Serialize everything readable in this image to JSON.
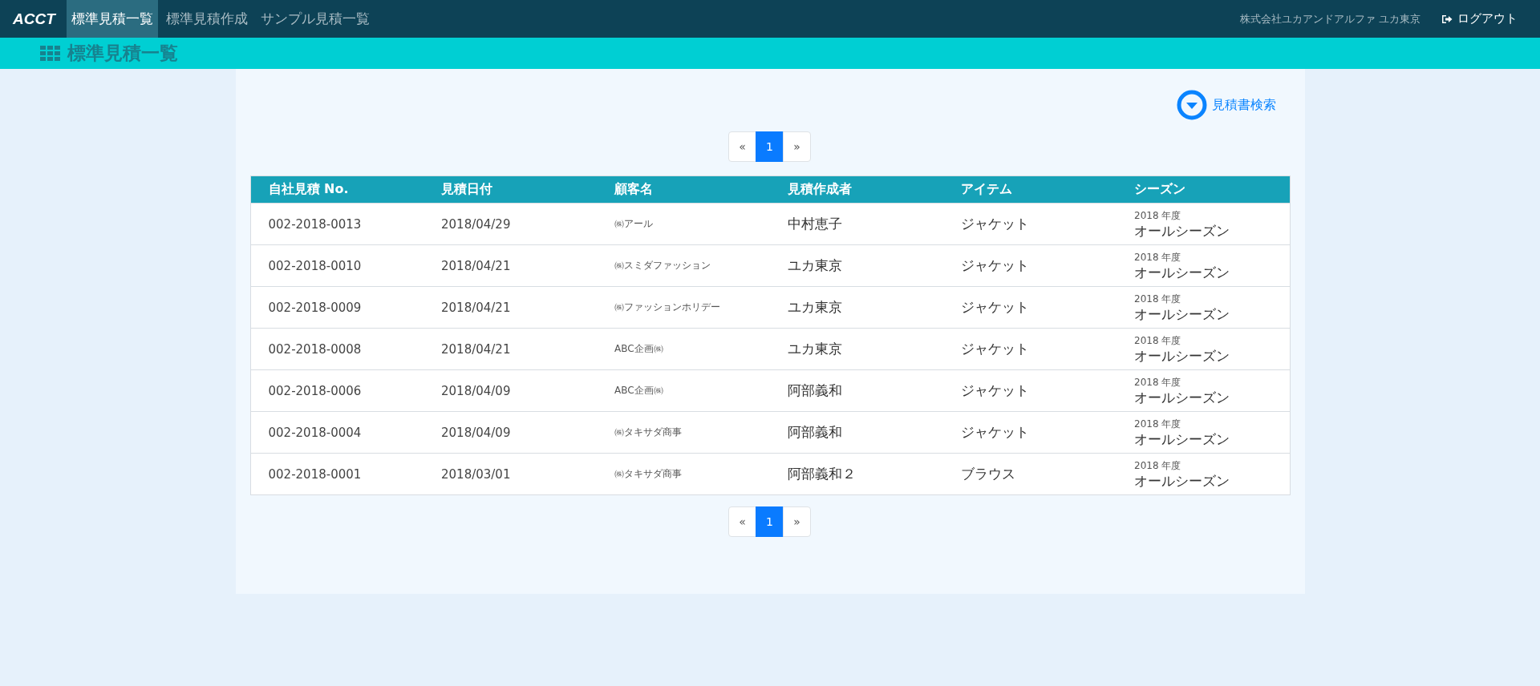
{
  "navbar": {
    "logo": "ACCT",
    "tabs": [
      {
        "label": "標準見積一覧",
        "selected": true
      },
      {
        "label": "標準見積作成",
        "selected": false
      },
      {
        "label": "サンプル見積一覧",
        "selected": false
      }
    ],
    "company": "株式会社ユカアンドアルファ ユカ東京",
    "logout": "ログアウト"
  },
  "page_title": "標準見積一覧",
  "search_toggle": "見積書検索",
  "pagination_top": {
    "prev": "«",
    "pages": [
      {
        "label": "1",
        "selected": true
      }
    ],
    "next": "»"
  },
  "table": {
    "columns": [
      "自社見積 No.",
      "見積日付",
      "顧客名",
      "見積作成者",
      "アイテム",
      "シーズン"
    ],
    "rows": [
      {
        "no": "002-2018-0013",
        "date": "2018/04/29",
        "customer": "㈱アール",
        "author": "中村恵子",
        "item": "ジャケット",
        "season_year": "2018 年度",
        "season": "オールシーズン"
      },
      {
        "no": "002-2018-0010",
        "date": "2018/04/21",
        "customer": "㈱スミダファッション",
        "author": "ユカ東京",
        "item": "ジャケット",
        "season_year": "2018 年度",
        "season": "オールシーズン"
      },
      {
        "no": "002-2018-0009",
        "date": "2018/04/21",
        "customer": "㈱ファッションホリデー",
        "author": "ユカ東京",
        "item": "ジャケット",
        "season_year": "2018 年度",
        "season": "オールシーズン"
      },
      {
        "no": "002-2018-0008",
        "date": "2018/04/21",
        "customer": "ABC企画㈱",
        "author": "ユカ東京",
        "item": "ジャケット",
        "season_year": "2018 年度",
        "season": "オールシーズン"
      },
      {
        "no": "002-2018-0006",
        "date": "2018/04/09",
        "customer": "ABC企画㈱",
        "author": "阿部義和",
        "item": "ジャケット",
        "season_year": "2018 年度",
        "season": "オールシーズン"
      },
      {
        "no": "002-2018-0004",
        "date": "2018/04/09",
        "customer": "㈱タキサダ商事",
        "author": "阿部義和",
        "item": "ジャケット",
        "season_year": "2018 年度",
        "season": "オールシーズン"
      },
      {
        "no": "002-2018-0001",
        "date": "2018/03/01",
        "customer": "㈱タキサダ商事",
        "author": "阿部義和２",
        "item": "ブラウス",
        "season_year": "2018 年度",
        "season": "オールシーズン"
      }
    ]
  },
  "pagination_bottom": {
    "prev": "«",
    "pages": [
      {
        "label": "1",
        "selected": true
      }
    ],
    "next": "»"
  }
}
